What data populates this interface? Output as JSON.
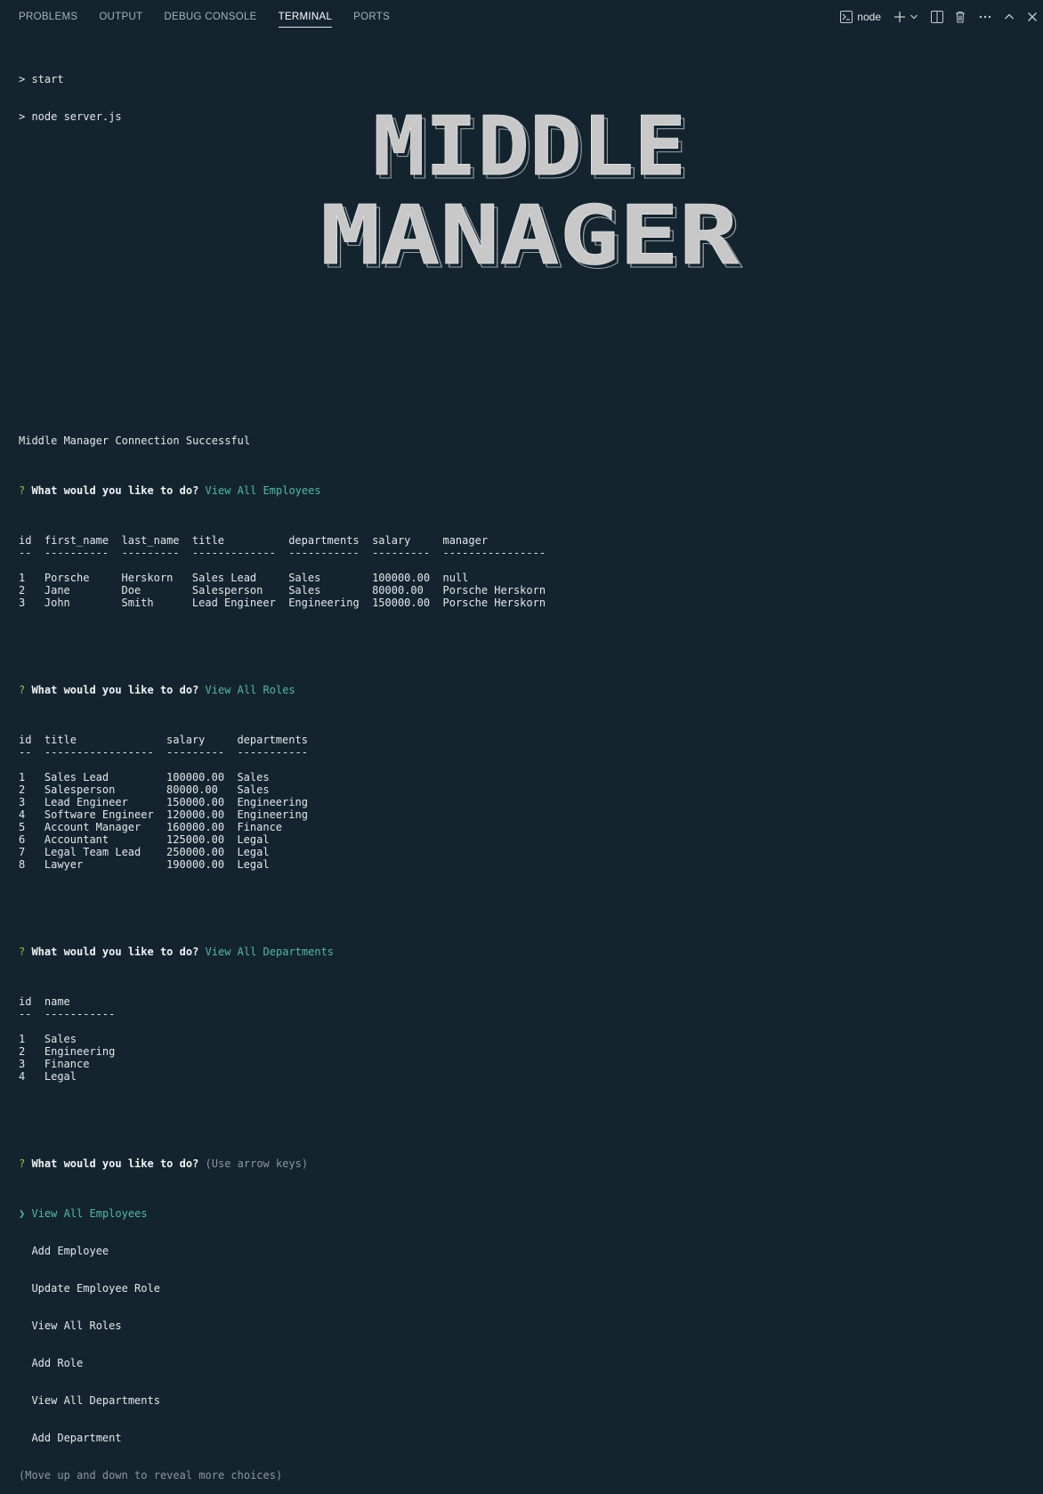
{
  "tabs": [
    {
      "label": "PROBLEMS"
    },
    {
      "label": "OUTPUT"
    },
    {
      "label": "DEBUG CONSOLE"
    },
    {
      "label": "TERMINAL",
      "active": true
    },
    {
      "label": "PORTS"
    }
  ],
  "toolbar": {
    "terminal_name": "node"
  },
  "startup": [
    "> start",
    "> node server.js"
  ],
  "banner": {
    "line1": "MIDDLE",
    "line2": "MANAGER"
  },
  "connection": "Middle Manager Connection Successful",
  "prompt": "What would you like to do?",
  "q1_answer": "View All Employees",
  "employees": {
    "headers": [
      "id",
      "first_name",
      "last_name",
      "title",
      "departments",
      "salary",
      "manager"
    ],
    "underline": [
      "--",
      "----------",
      "---------",
      "-------------",
      "-----------",
      "---------",
      "----------------"
    ],
    "rows": [
      [
        "1",
        "Porsche",
        "Herskorn",
        "Sales Lead",
        "Sales",
        "100000.00",
        "null"
      ],
      [
        "2",
        "Jane",
        "Doe",
        "Salesperson",
        "Sales",
        "80000.00",
        "Porsche Herskorn"
      ],
      [
        "3",
        "John",
        "Smith",
        "Lead Engineer",
        "Engineering",
        "150000.00",
        "Porsche Herskorn"
      ]
    ]
  },
  "q2_answer": "View All Roles",
  "roles": {
    "headers": [
      "id",
      "title",
      "salary",
      "departments"
    ],
    "underline": [
      "--",
      "-----------------",
      "---------",
      "-----------"
    ],
    "rows": [
      [
        "1",
        "Sales Lead",
        "100000.00",
        "Sales"
      ],
      [
        "2",
        "Salesperson",
        "80000.00",
        "Sales"
      ],
      [
        "3",
        "Lead Engineer",
        "150000.00",
        "Engineering"
      ],
      [
        "4",
        "Software Engineer",
        "120000.00",
        "Engineering"
      ],
      [
        "5",
        "Account Manager",
        "160000.00",
        "Finance"
      ],
      [
        "6",
        "Accountant",
        "125000.00",
        "Legal"
      ],
      [
        "7",
        "Legal Team Lead",
        "250000.00",
        "Legal"
      ],
      [
        "8",
        "Lawyer",
        "190000.00",
        "Legal"
      ]
    ]
  },
  "q3_answer": "View All Departments",
  "departments": {
    "headers": [
      "id",
      "name"
    ],
    "underline": [
      "--",
      "-----------"
    ],
    "rows": [
      [
        "1",
        "Sales"
      ],
      [
        "2",
        "Engineering"
      ],
      [
        "3",
        "Finance"
      ],
      [
        "4",
        "Legal"
      ]
    ]
  },
  "q4_hint": "(Use arrow keys)",
  "menu": {
    "pointer": "❯",
    "selected": "View All Employees",
    "items": [
      "Add Employee",
      "Update Employee Role",
      "View All Roles",
      "Add Role",
      "View All Departments",
      "Add Department"
    ],
    "footer": "(Move up and down to reveal more choices)"
  },
  "colors": {
    "background": "#13242f",
    "prompt_mark": "#8ec33f",
    "answer": "#54b7a4",
    "dim": "#8b979f",
    "banner_fill": "#c8c8c8"
  }
}
